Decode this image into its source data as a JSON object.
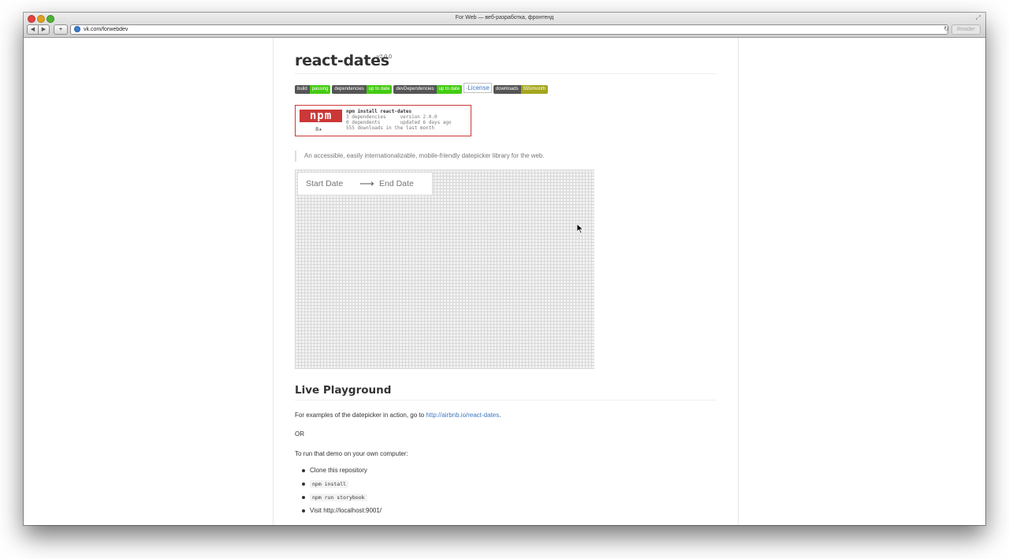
{
  "window": {
    "title": "For Web — веб-разработка, фронтенд",
    "url": "vk.com/forwebdev",
    "reader_label": "Reader"
  },
  "toolbar": {
    "back_icon": "◀",
    "forward_icon": "▶",
    "add_icon": "+",
    "reload_icon": "↻"
  },
  "readme": {
    "title": "react-dates",
    "version": "v2.0.0",
    "badges": [
      {
        "left": "build",
        "right": "passing",
        "color": "#44cc11"
      },
      {
        "left": "dependencies",
        "right": "up to date",
        "color": "#44cc11"
      },
      {
        "left": "devDependencies",
        "right": "up to date",
        "color": "#44cc11"
      },
      {
        "alt": "License"
      },
      {
        "left": "downloads",
        "right": "555/month",
        "color": "#a4a61d"
      }
    ],
    "npm_card": {
      "logo": "npm",
      "stars": "8★",
      "command": "npm install react-dates",
      "line1": "3 dependencies     version 2.0.0",
      "line2": "0 dependents       updated 6 days ago",
      "line3": "555 downloads in the last month"
    },
    "description": "An accessible, easily internationalizable, mobile-friendly datepicker library for the web.",
    "demo": {
      "start_placeholder": "Start Date",
      "arrow": "⟶",
      "end_placeholder": "End Date"
    },
    "playground": {
      "heading": "Live Playground",
      "intro_prefix": "For examples of the datepicker in action, go to ",
      "intro_link": "http://airbnb.io/react-dates",
      "intro_suffix": ".",
      "or": "OR",
      "run_demo": "To run that demo on your own computer:",
      "steps": [
        {
          "text": "Clone this repository",
          "code": false
        },
        {
          "text": "npm install",
          "code": true
        },
        {
          "text": "npm run storybook",
          "code": true
        },
        {
          "text": "Visit http://localhost:9001/",
          "code": false
        }
      ]
    }
  }
}
